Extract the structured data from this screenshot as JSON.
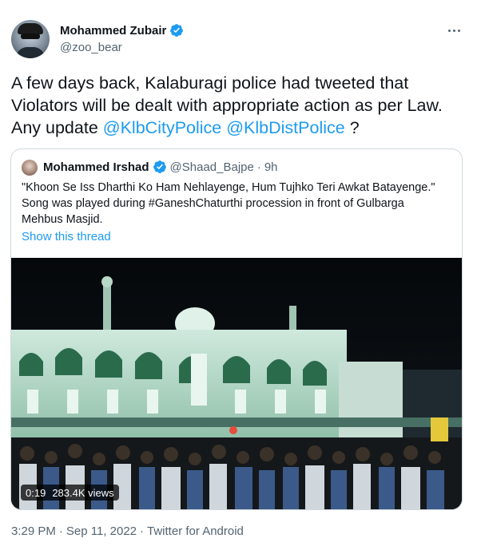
{
  "author": {
    "name": "Mohammed Zubair",
    "handle": "@zoo_bear",
    "verified": true
  },
  "tweet": {
    "text_before": "A few days back, Kalaburagi police had tweeted that Violators will be dealt with appropriate action as per Law. Any update ",
    "mention_1": "@KlbCityPolice",
    "mention_2": "@KlbDistPolice",
    "text_after": " ?",
    "timestamp": "3:29 PM",
    "date": "Sep 11, 2022",
    "separator": "·",
    "source": "Twitter for Android"
  },
  "quoted": {
    "name": "Mohammed Irshad",
    "handle": "@Shaad_Bajpe",
    "separator": "·",
    "time": "9h",
    "lines": [
      "\"Khoon Se Iss Dharthi Ko Ham Nehlayenge, Hum Tujhko Teri Awkat Batayenge.\"",
      "Song was played during #GaneshChaturthi procession in front of Gulbarga",
      "Mehbus Masjid."
    ],
    "show_thread": "Show this thread",
    "video": {
      "duration": "0:19",
      "views": "283.4K views"
    }
  },
  "icons": {
    "verified": "verified-badge-icon",
    "more": "more-horizontal-icon"
  },
  "colors": {
    "accent": "#1d9bf0",
    "text": "#0f1419",
    "muted": "#536471",
    "border": "#cfd9de"
  }
}
